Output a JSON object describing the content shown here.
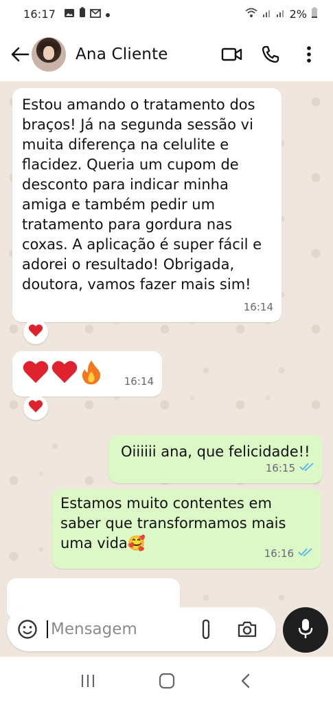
{
  "status_bar": {
    "time": "16:17",
    "battery": "2%",
    "icons": [
      "image-icon",
      "battery-saver-icon",
      "gmail-icon",
      "dot-icon",
      "wifi-icon",
      "signal-icon",
      "signal-icon",
      "battery-icon"
    ]
  },
  "header": {
    "contact_name": "Ana Cliente",
    "icons": [
      "back-arrow-icon",
      "video-call-icon",
      "phone-icon",
      "more-vert-icon"
    ]
  },
  "messages": [
    {
      "direction": "incoming",
      "text": "Estou amando o tratamento dos braços! Já na segunda sessão vi muita diferença na celulite e flacidez. Queria um cupom de desconto para indicar minha amiga e também pedir um tratamento para gordura nas coxas. A aplicação é super fácil e adorei o resultado! Obrigada, doutora, vamos fazer mais sim!",
      "time": "16:14",
      "reaction": "❤️"
    },
    {
      "direction": "incoming",
      "text": "❤️❤️🔥",
      "time": "16:14",
      "reaction": "❤️"
    },
    {
      "direction": "outgoing",
      "text": "Oiiiiii ana, que felicidade!!",
      "time": "16:15",
      "status": "read"
    },
    {
      "direction": "outgoing",
      "text": "Estamos muito contentes em saber que transformamos mais uma vida🥰",
      "time": "16:16",
      "status": "read"
    }
  ],
  "composer": {
    "placeholder": "Mensagem",
    "icons": [
      "emoji-icon",
      "attach-icon",
      "camera-icon",
      "mic-icon"
    ]
  },
  "navbar": {
    "icons": [
      "recents-icon",
      "home-icon",
      "back-icon"
    ]
  },
  "colors": {
    "chat_bg": "#efe7dd",
    "incoming_bubble": "#ffffff",
    "outgoing_bubble": "#dcf8c6",
    "read_ticks": "#4fb6ec",
    "mic_button": "#1f1f1f"
  }
}
